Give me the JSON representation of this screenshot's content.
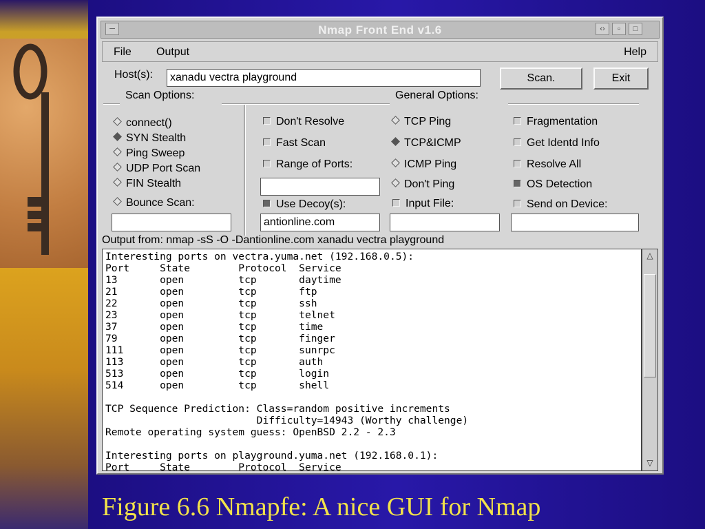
{
  "window": {
    "title": "Nmap Front End v1.6"
  },
  "menu": {
    "file": "File",
    "output": "Output",
    "help": "Help"
  },
  "hosts": {
    "label": "Host(s):",
    "value": "xanadu vectra playground"
  },
  "buttons": {
    "scan": "Scan.",
    "exit": "Exit"
  },
  "scan_options": {
    "heading": "Scan Options:",
    "items": [
      {
        "label": "connect()",
        "selected": false
      },
      {
        "label": "SYN Stealth",
        "selected": true
      },
      {
        "label": "Ping Sweep",
        "selected": false
      },
      {
        "label": "UDP Port Scan",
        "selected": false
      },
      {
        "label": "FIN Stealth",
        "selected": false
      },
      {
        "label": "Bounce Scan:",
        "selected": false
      }
    ],
    "bounce_value": ""
  },
  "general_options": {
    "heading": "General Options:",
    "col1": [
      {
        "label": "Don't Resolve",
        "checked": false
      },
      {
        "label": "Fast Scan",
        "checked": false
      },
      {
        "label": "Range of Ports:",
        "checked": false
      }
    ],
    "range_value": "",
    "decoy": {
      "label": "Use Decoy(s):",
      "checked": true,
      "value": "antionline.com"
    },
    "ping": [
      {
        "label": "TCP Ping",
        "selected": false
      },
      {
        "label": "TCP&ICMP",
        "selected": true
      },
      {
        "label": "ICMP Ping",
        "selected": false
      },
      {
        "label": "Don't Ping",
        "selected": false
      }
    ],
    "input_file": {
      "label": "Input File:",
      "checked": false,
      "value": ""
    },
    "col3": [
      {
        "label": "Fragmentation",
        "checked": false
      },
      {
        "label": "Get Identd Info",
        "checked": false
      },
      {
        "label": "Resolve All",
        "checked": false
      },
      {
        "label": "OS Detection",
        "checked": true
      }
    ],
    "send_device": {
      "label": "Send on Device:",
      "checked": false,
      "value": ""
    }
  },
  "output_from": "Output from:  nmap -sS -O -Dantionline.com xanadu vectra playground",
  "output_lines": [
    "Interesting ports on vectra.yuma.net (192.168.0.5):",
    "Port     State        Protocol  Service",
    "13       open         tcp       daytime",
    "21       open         tcp       ftp",
    "22       open         tcp       ssh",
    "23       open         tcp       telnet",
    "37       open         tcp       time",
    "79       open         tcp       finger",
    "111      open         tcp       sunrpc",
    "113      open         tcp       auth",
    "513      open         tcp       login",
    "514      open         tcp       shell",
    "",
    "TCP Sequence Prediction: Class=random positive increments",
    "                         Difficulty=14943 (Worthy challenge)",
    "Remote operating system guess: OpenBSD 2.2 - 2.3",
    "",
    "Interesting ports on playground.yuma.net (192.168.0.1):",
    "Port     State        Protocol  Service"
  ],
  "caption": "Figure 6.6  Nmapfe: A nice GUI for Nmap"
}
